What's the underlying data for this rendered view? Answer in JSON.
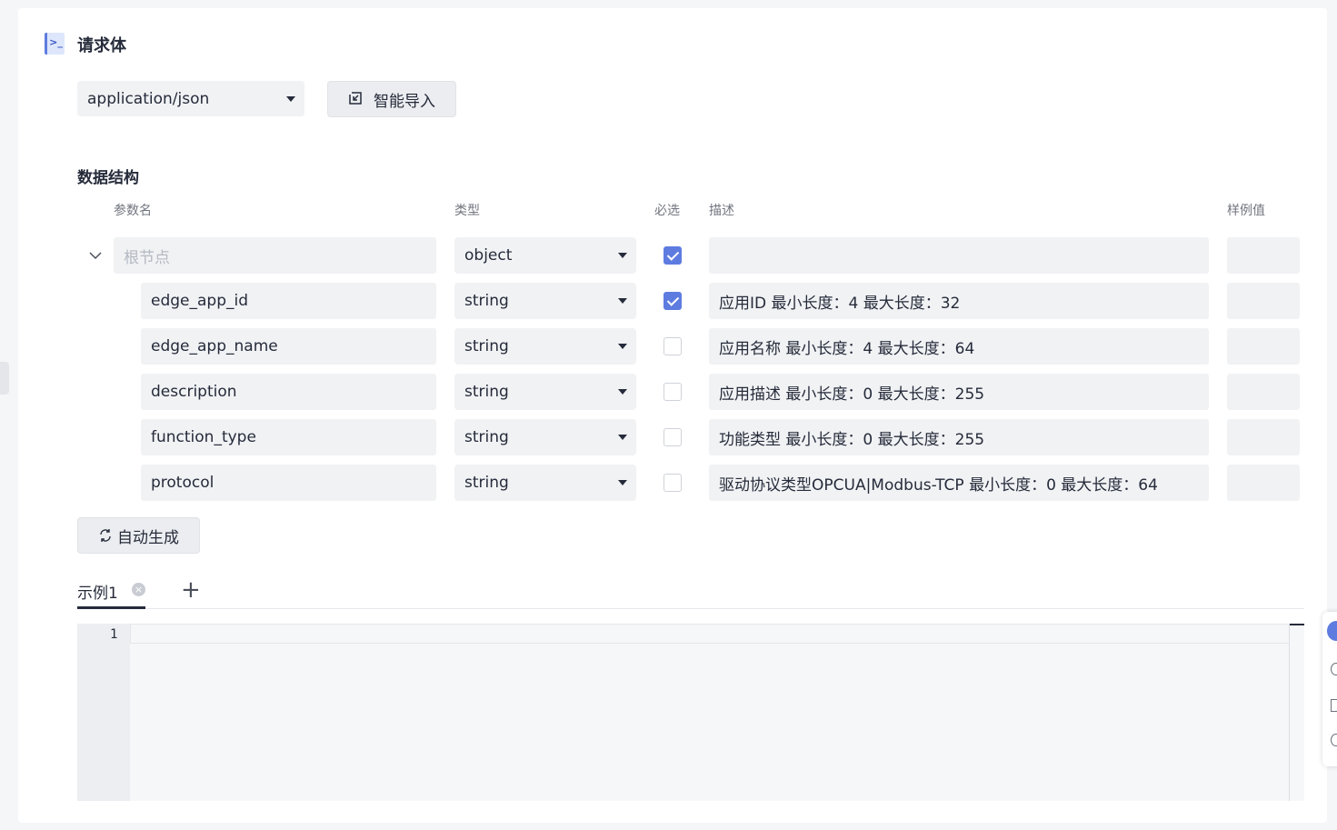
{
  "section": {
    "title": "请求体"
  },
  "content_type": {
    "selected": "application/json"
  },
  "smart_import": {
    "label": "智能导入"
  },
  "data_structure": {
    "title": "数据结构"
  },
  "columns": {
    "param_name": "参数名",
    "type": "类型",
    "required": "必选",
    "description": "描述",
    "example": "样例值"
  },
  "root": {
    "placeholder": "根节点",
    "type": "object",
    "required": true,
    "description": "",
    "example": ""
  },
  "fields": [
    {
      "name": "edge_app_id",
      "type": "string",
      "required": true,
      "description": "应用ID  最小长度：4  最大长度：32",
      "example": ""
    },
    {
      "name": "edge_app_name",
      "type": "string",
      "required": false,
      "description": "应用名称  最小长度：4  最大长度：64",
      "example": ""
    },
    {
      "name": "description",
      "type": "string",
      "required": false,
      "description": "应用描述  最小长度：0  最大长度：255",
      "example": ""
    },
    {
      "name": "function_type",
      "type": "string",
      "required": false,
      "description": "功能类型 最小长度：0  最大长度：255",
      "example": ""
    },
    {
      "name": "protocol",
      "type": "string",
      "required": false,
      "description": "驱动协议类型OPCUA|Modbus-TCP  最小长度：0  最大长度：64",
      "example": ""
    }
  ],
  "auto_generate": {
    "label": "自动生成"
  },
  "tabs": [
    {
      "label": "示例1"
    }
  ],
  "editor": {
    "line_numbers": [
      "1"
    ]
  },
  "colors": {
    "accent": "#5e7ce0",
    "field_bg": "#f1f2f4"
  }
}
